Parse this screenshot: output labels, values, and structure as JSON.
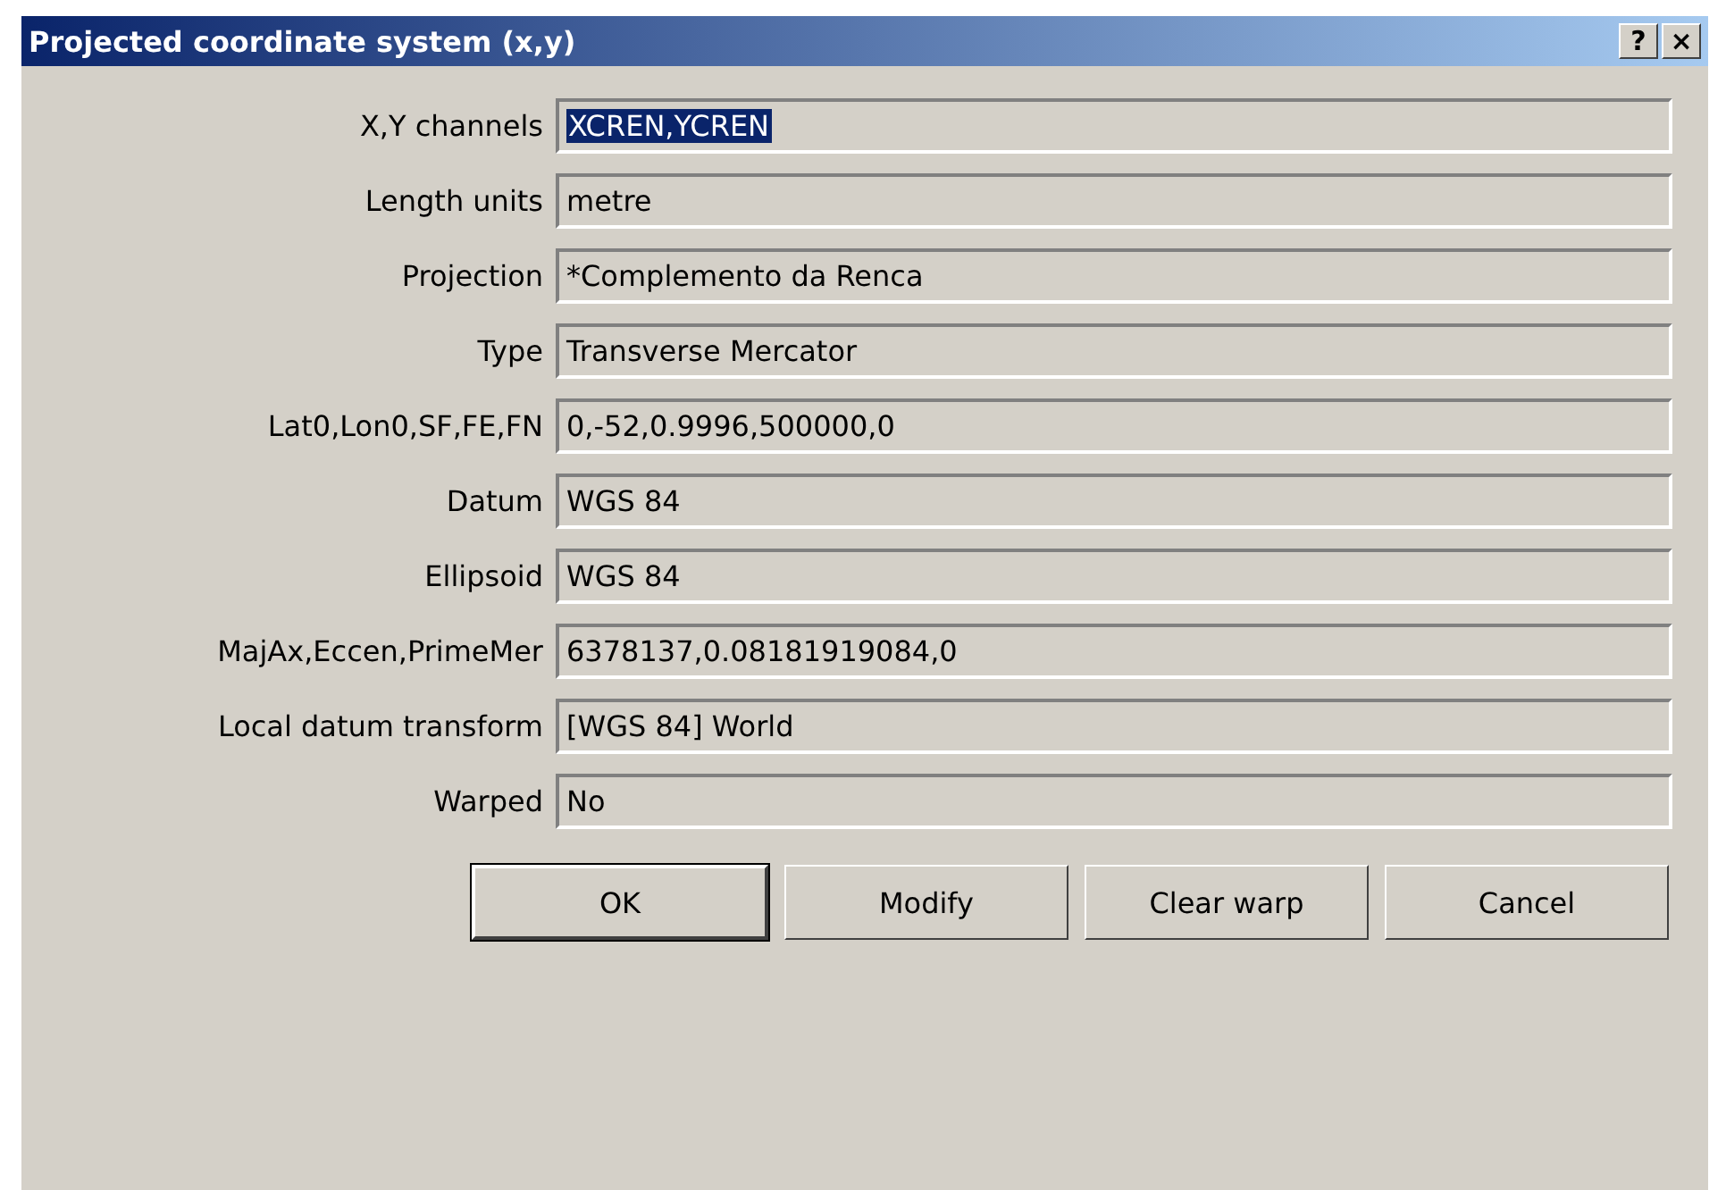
{
  "window": {
    "title": "Projected coordinate system (x,y)",
    "title_buttons": [
      "?",
      "×"
    ]
  },
  "fields": [
    {
      "label": "X,Y channels",
      "value": "XCREN,YCREN",
      "highlighted": true
    },
    {
      "label": "Length units",
      "value": "metre",
      "highlighted": false
    },
    {
      "label": "Projection",
      "value": "*Complemento da Renca",
      "highlighted": false
    },
    {
      "label": "Type",
      "value": "Transverse Mercator",
      "highlighted": false
    },
    {
      "label": "Lat0,Lon0,SF,FE,FN",
      "value": "0,-52,0.9996,500000,0",
      "highlighted": false
    },
    {
      "label": "Datum",
      "value": "WGS 84",
      "highlighted": false
    },
    {
      "label": "Ellipsoid",
      "value": "WGS 84",
      "highlighted": false
    },
    {
      "label": "MajAx,Eccen,PrimeMer",
      "value": "6378137,0.08181919084,0",
      "highlighted": false
    },
    {
      "label": "Local datum transform",
      "value": "[WGS 84] World",
      "highlighted": false
    },
    {
      "label": "Warped",
      "value": "No",
      "highlighted": false
    }
  ],
  "buttons": [
    {
      "label": "OK",
      "default": true
    },
    {
      "label": "Modify",
      "default": false
    },
    {
      "label": "Clear warp",
      "default": false
    },
    {
      "label": "Cancel",
      "default": false
    }
  ]
}
